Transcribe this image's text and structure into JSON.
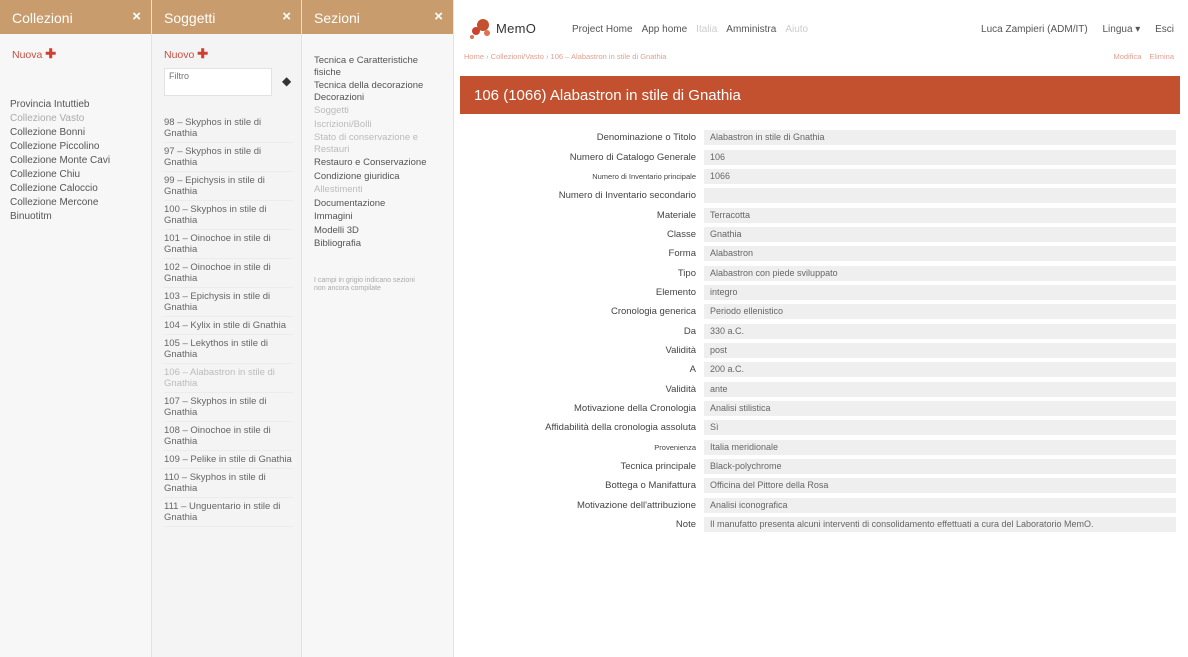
{
  "collezioni": {
    "title": "Collezioni",
    "close": "×",
    "new_label": "Nuova",
    "items": [
      {
        "label": "Provincia Intuttieb",
        "muted": false
      },
      {
        "label": "Collezione Vasto",
        "muted": true
      },
      {
        "label": "Collezione Bonni",
        "muted": false
      },
      {
        "label": "Collezione Piccolino",
        "muted": false
      },
      {
        "label": "Collezione Monte Cavi",
        "muted": false
      },
      {
        "label": "Collezione Chiu",
        "muted": false
      },
      {
        "label": "Collezione Caloccio",
        "muted": false
      },
      {
        "label": "Collezione Mercone",
        "muted": false
      },
      {
        "label": "Binuotitm",
        "muted": false
      }
    ]
  },
  "soggetti": {
    "title": "Soggetti",
    "close": "×",
    "new_label": "Nuovo",
    "filter_placeholder": "Filtro",
    "items": [
      {
        "label": "98 – Skyphos in stile di Gnathia",
        "selected": false
      },
      {
        "label": "97 – Skyphos in stile di Gnathia",
        "selected": false
      },
      {
        "label": "99 – Epichysis in stile di Gnathia",
        "selected": false
      },
      {
        "label": "100 – Skyphos in stile di Gnathia",
        "selected": false
      },
      {
        "label": "101 – Oinochoe in stile di Gnathia",
        "selected": false
      },
      {
        "label": "102 – Oinochoe in stile di Gnathia",
        "selected": false
      },
      {
        "label": "103 – Epichysis in stile di Gnathia",
        "selected": false
      },
      {
        "label": "104 – Kylix in stile di Gnathia",
        "selected": false
      },
      {
        "label": "105 – Lekythos in stile di Gnathia",
        "selected": false
      },
      {
        "label": "106 – Alabastron in stile di Gnathia",
        "selected": true
      },
      {
        "label": "107 – Skyphos in stile di Gnathia",
        "selected": false
      },
      {
        "label": "108 – Oinochoe in stile di Gnathia",
        "selected": false
      },
      {
        "label": "109 – Pelike in stile di Gnathia",
        "selected": false
      },
      {
        "label": "110 – Skyphos in stile di Gnathia",
        "selected": false
      },
      {
        "label": "111 – Unguentario in stile di Gnathia",
        "selected": false
      }
    ]
  },
  "sezioni": {
    "title": "Sezioni",
    "close": "×",
    "items": [
      {
        "label": "Tecnica e Caratteristiche fisiche",
        "muted": false
      },
      {
        "label": "Tecnica della decorazione Decorazioni",
        "muted": false
      },
      {
        "label": "Soggetti",
        "muted": true
      },
      {
        "label": "Iscrizioni/Bolli",
        "muted": true
      },
      {
        "label": "Stato di conservazione e Restauri",
        "muted": true
      },
      {
        "label": "Restauro e Conservazione",
        "muted": false
      },
      {
        "label": "Condizione giuridica",
        "muted": false
      },
      {
        "label": "Allestimenti",
        "muted": true
      },
      {
        "label": "Documentazione",
        "muted": false
      },
      {
        "label": "Immagini",
        "muted": false
      },
      {
        "label": "Modelli 3D",
        "muted": false
      },
      {
        "label": "Bibliografia",
        "muted": false
      }
    ],
    "note": "I campi in grigio indicano sezioni non ancora compilate"
  },
  "topbar": {
    "logo_text": "MemO",
    "nav": [
      {
        "label": "Project Home",
        "faded": false
      },
      {
        "label": "App home",
        "faded": false
      },
      {
        "label": "Italia",
        "faded": true
      },
      {
        "label": "Amministra",
        "faded": false
      },
      {
        "label": "Aiuto",
        "faded": true
      }
    ],
    "user": "Luca Zampieri (ADM/IT)",
    "language": "Lingua ▾",
    "logout": "Esci"
  },
  "subbar": {
    "breadcrumb": "Home › Collezioni/Vasto › 106 – Alabastron in stile di Gnathia",
    "actions": [
      "Modifica",
      "Elimina"
    ]
  },
  "record": {
    "title": "106 (1066) Alabastron in stile di Gnathia",
    "fields": [
      {
        "label": "Denominazione o Titolo",
        "value": "Alabastron in stile di Gnathia",
        "small": false
      },
      {
        "label": "Numero di Catalogo Generale",
        "value": "106",
        "small": false
      },
      {
        "label": "Numero di Inventario principale",
        "value": "1066",
        "small": true
      },
      {
        "label": "Numero di Inventario secondario",
        "value": "",
        "small": false
      },
      {
        "label": "Materiale",
        "value": "Terracotta",
        "small": false
      },
      {
        "label": "Classe",
        "value": "Gnathia",
        "small": false
      },
      {
        "label": "Forma",
        "value": "Alabastron",
        "small": false
      },
      {
        "label": "Tipo",
        "value": "Alabastron con piede sviluppato",
        "small": false
      },
      {
        "label": "Elemento",
        "value": "integro",
        "small": false
      },
      {
        "label": "Cronologia generica",
        "value": "Periodo ellenistico",
        "small": false
      },
      {
        "label": "Da",
        "value": "330 a.C.",
        "small": false
      },
      {
        "label": "Validità",
        "value": "post",
        "small": false
      },
      {
        "label": "A",
        "value": "200 a.C.",
        "small": false
      },
      {
        "label": "Validità",
        "value": "ante",
        "small": false
      },
      {
        "label": "Motivazione della Cronologia",
        "value": "Analisi stilistica",
        "small": false
      },
      {
        "label": "Affidabilità della cronologia assoluta",
        "value": "Sì",
        "small": false
      },
      {
        "label": "Provenienza",
        "value": "Italia meridionale",
        "small": true
      },
      {
        "label": "Tecnica principale",
        "value": "Black-polychrome",
        "small": false
      },
      {
        "label": "Bottega o Manifattura",
        "value": "Officina del Pittore della Rosa",
        "small": false
      },
      {
        "label": "Motivazione dell'attribuzione",
        "value": "Analisi iconografica",
        "small": false
      },
      {
        "label": "Note",
        "value": "Il manufatto presenta alcuni interventi di consolidamento effettuati a cura del Laboratorio MemO.",
        "small": false
      }
    ]
  },
  "colors": {
    "column_header": "#c89c6c",
    "title_bar": "#c3502e",
    "accent_red": "#d04030"
  }
}
